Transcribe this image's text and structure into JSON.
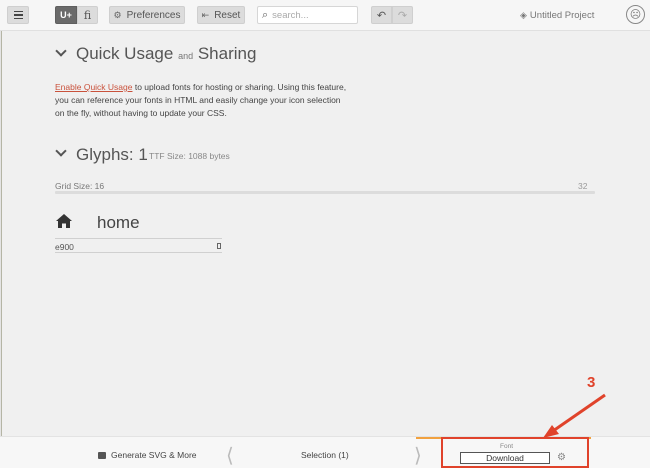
{
  "toolbar": {
    "seg_unicode_label": "U+",
    "seg_ligature_label": "fi",
    "preferences_label": "Preferences",
    "reset_label": "Reset",
    "search_placeholder": "search...",
    "project_name": "Untitled Project"
  },
  "quick_usage": {
    "title": "Quick Usage",
    "title_and": "and",
    "title_sharing": "Sharing",
    "link_text": "Enable Quick Usage",
    "description_1": " to upload fonts for hosting or sharing. Using this feature,",
    "description_2": "you can reference your fonts in HTML and easily change your icon selection",
    "description_3": "on the fly, without having to update your CSS."
  },
  "glyphs": {
    "title": "Glyphs: 1",
    "ttf_size": "TTF Size: 1088 bytes",
    "grid_size_label": "Grid Size: 16",
    "grid_max": "32",
    "items": [
      {
        "icon": "home-icon",
        "name": "home",
        "code": "e900"
      }
    ]
  },
  "bottom_bar": {
    "generate_label": "Generate SVG & More",
    "selection_label": "Selection (1)",
    "font_label": "Font",
    "download_label": "Download"
  },
  "annotation": {
    "number": "3",
    "color": "#e0432b"
  },
  "colors": {
    "accent_orange": "#f1a13f",
    "link_red": "#c9523c",
    "active_segment": "#6a6a6a"
  }
}
